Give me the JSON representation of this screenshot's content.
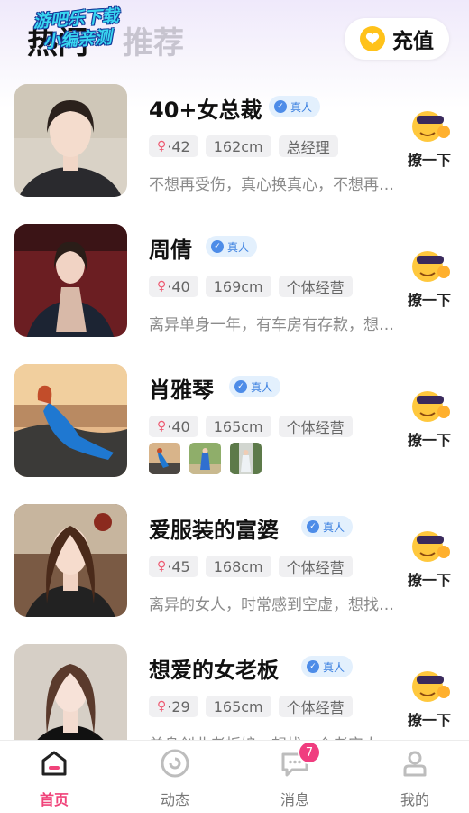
{
  "header": {
    "tab_hot": "热门",
    "tab_recommend": "推荐",
    "watermark_line1": "游吧乐下载",
    "watermark_line2": "小编亲测",
    "recharge_label": "充值",
    "recharge_icon": "heart-coin-icon"
  },
  "colors": {
    "accent": "#f0437a",
    "verify_bg": "#e3f0fd",
    "verify_text": "#3a7fe0",
    "tag_bg": "#f0f0f2",
    "badge": "#f03d7f"
  },
  "verify_label": "真人",
  "poke_label": "撩一下",
  "poke_icon": "sunglasses-emoji-icon",
  "profiles": [
    {
      "name": "40+女总裁",
      "age": "·42",
      "height": "162cm",
      "job": "总经理",
      "desc": "不想再受伤，真心换真心，不想再受伤"
    },
    {
      "name": "周倩",
      "age": "·40",
      "height": "169cm",
      "job": "个体经营",
      "desc": "离异单身一年，有车房有存款，想找人"
    },
    {
      "name": "肖雅琴",
      "age": "·40",
      "height": "165cm",
      "job": "个体经营",
      "photo_count": 3
    },
    {
      "name": "爱服装的富婆",
      "age": "·45",
      "height": "168cm",
      "job": "个体经营",
      "desc": "离异的女人，时常感到空虚，想找人陪"
    },
    {
      "name": "想爱的女老板",
      "age": "·29",
      "height": "165cm",
      "job": "个体经营",
      "desc": "单身创业老板娘，想找一个老实人"
    }
  ],
  "tabbar": [
    {
      "label": "首页",
      "icon": "home-icon",
      "active": true
    },
    {
      "label": "动态",
      "icon": "moments-icon"
    },
    {
      "label": "消息",
      "icon": "chat-icon",
      "badge": "7"
    },
    {
      "label": "我的",
      "icon": "profile-icon"
    }
  ]
}
